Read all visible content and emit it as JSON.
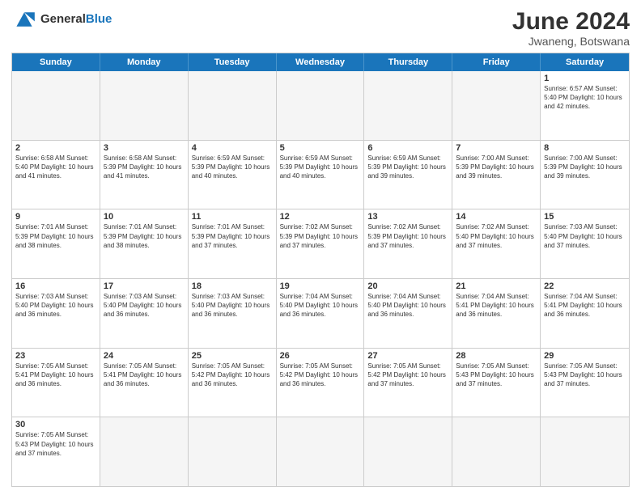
{
  "header": {
    "logo_general": "General",
    "logo_blue": "Blue",
    "title": "June 2024",
    "subtitle": "Jwaneng, Botswana"
  },
  "days": [
    "Sunday",
    "Monday",
    "Tuesday",
    "Wednesday",
    "Thursday",
    "Friday",
    "Saturday"
  ],
  "weeks": [
    [
      {
        "num": "",
        "info": "",
        "empty": true
      },
      {
        "num": "",
        "info": "",
        "empty": true
      },
      {
        "num": "",
        "info": "",
        "empty": true
      },
      {
        "num": "",
        "info": "",
        "empty": true
      },
      {
        "num": "",
        "info": "",
        "empty": true
      },
      {
        "num": "",
        "info": "",
        "empty": true
      },
      {
        "num": "1",
        "info": "Sunrise: 6:57 AM\nSunset: 5:40 PM\nDaylight: 10 hours and 42 minutes.",
        "empty": false
      }
    ],
    [
      {
        "num": "2",
        "info": "Sunrise: 6:58 AM\nSunset: 5:40 PM\nDaylight: 10 hours and 41 minutes.",
        "empty": false
      },
      {
        "num": "3",
        "info": "Sunrise: 6:58 AM\nSunset: 5:39 PM\nDaylight: 10 hours and 41 minutes.",
        "empty": false
      },
      {
        "num": "4",
        "info": "Sunrise: 6:59 AM\nSunset: 5:39 PM\nDaylight: 10 hours and 40 minutes.",
        "empty": false
      },
      {
        "num": "5",
        "info": "Sunrise: 6:59 AM\nSunset: 5:39 PM\nDaylight: 10 hours and 40 minutes.",
        "empty": false
      },
      {
        "num": "6",
        "info": "Sunrise: 6:59 AM\nSunset: 5:39 PM\nDaylight: 10 hours and 39 minutes.",
        "empty": false
      },
      {
        "num": "7",
        "info": "Sunrise: 7:00 AM\nSunset: 5:39 PM\nDaylight: 10 hours and 39 minutes.",
        "empty": false
      },
      {
        "num": "8",
        "info": "Sunrise: 7:00 AM\nSunset: 5:39 PM\nDaylight: 10 hours and 39 minutes.",
        "empty": false
      }
    ],
    [
      {
        "num": "9",
        "info": "Sunrise: 7:01 AM\nSunset: 5:39 PM\nDaylight: 10 hours and 38 minutes.",
        "empty": false
      },
      {
        "num": "10",
        "info": "Sunrise: 7:01 AM\nSunset: 5:39 PM\nDaylight: 10 hours and 38 minutes.",
        "empty": false
      },
      {
        "num": "11",
        "info": "Sunrise: 7:01 AM\nSunset: 5:39 PM\nDaylight: 10 hours and 37 minutes.",
        "empty": false
      },
      {
        "num": "12",
        "info": "Sunrise: 7:02 AM\nSunset: 5:39 PM\nDaylight: 10 hours and 37 minutes.",
        "empty": false
      },
      {
        "num": "13",
        "info": "Sunrise: 7:02 AM\nSunset: 5:39 PM\nDaylight: 10 hours and 37 minutes.",
        "empty": false
      },
      {
        "num": "14",
        "info": "Sunrise: 7:02 AM\nSunset: 5:40 PM\nDaylight: 10 hours and 37 minutes.",
        "empty": false
      },
      {
        "num": "15",
        "info": "Sunrise: 7:03 AM\nSunset: 5:40 PM\nDaylight: 10 hours and 37 minutes.",
        "empty": false
      }
    ],
    [
      {
        "num": "16",
        "info": "Sunrise: 7:03 AM\nSunset: 5:40 PM\nDaylight: 10 hours and 36 minutes.",
        "empty": false
      },
      {
        "num": "17",
        "info": "Sunrise: 7:03 AM\nSunset: 5:40 PM\nDaylight: 10 hours and 36 minutes.",
        "empty": false
      },
      {
        "num": "18",
        "info": "Sunrise: 7:03 AM\nSunset: 5:40 PM\nDaylight: 10 hours and 36 minutes.",
        "empty": false
      },
      {
        "num": "19",
        "info": "Sunrise: 7:04 AM\nSunset: 5:40 PM\nDaylight: 10 hours and 36 minutes.",
        "empty": false
      },
      {
        "num": "20",
        "info": "Sunrise: 7:04 AM\nSunset: 5:40 PM\nDaylight: 10 hours and 36 minutes.",
        "empty": false
      },
      {
        "num": "21",
        "info": "Sunrise: 7:04 AM\nSunset: 5:41 PM\nDaylight: 10 hours and 36 minutes.",
        "empty": false
      },
      {
        "num": "22",
        "info": "Sunrise: 7:04 AM\nSunset: 5:41 PM\nDaylight: 10 hours and 36 minutes.",
        "empty": false
      }
    ],
    [
      {
        "num": "23",
        "info": "Sunrise: 7:05 AM\nSunset: 5:41 PM\nDaylight: 10 hours and 36 minutes.",
        "empty": false
      },
      {
        "num": "24",
        "info": "Sunrise: 7:05 AM\nSunset: 5:41 PM\nDaylight: 10 hours and 36 minutes.",
        "empty": false
      },
      {
        "num": "25",
        "info": "Sunrise: 7:05 AM\nSunset: 5:42 PM\nDaylight: 10 hours and 36 minutes.",
        "empty": false
      },
      {
        "num": "26",
        "info": "Sunrise: 7:05 AM\nSunset: 5:42 PM\nDaylight: 10 hours and 36 minutes.",
        "empty": false
      },
      {
        "num": "27",
        "info": "Sunrise: 7:05 AM\nSunset: 5:42 PM\nDaylight: 10 hours and 37 minutes.",
        "empty": false
      },
      {
        "num": "28",
        "info": "Sunrise: 7:05 AM\nSunset: 5:43 PM\nDaylight: 10 hours and 37 minutes.",
        "empty": false
      },
      {
        "num": "29",
        "info": "Sunrise: 7:05 AM\nSunset: 5:43 PM\nDaylight: 10 hours and 37 minutes.",
        "empty": false
      }
    ],
    [
      {
        "num": "30",
        "info": "Sunrise: 7:05 AM\nSunset: 5:43 PM\nDaylight: 10 hours and 37 minutes.",
        "empty": false
      },
      {
        "num": "",
        "info": "",
        "empty": true
      },
      {
        "num": "",
        "info": "",
        "empty": true
      },
      {
        "num": "",
        "info": "",
        "empty": true
      },
      {
        "num": "",
        "info": "",
        "empty": true
      },
      {
        "num": "",
        "info": "",
        "empty": true
      },
      {
        "num": "",
        "info": "",
        "empty": true
      }
    ]
  ]
}
